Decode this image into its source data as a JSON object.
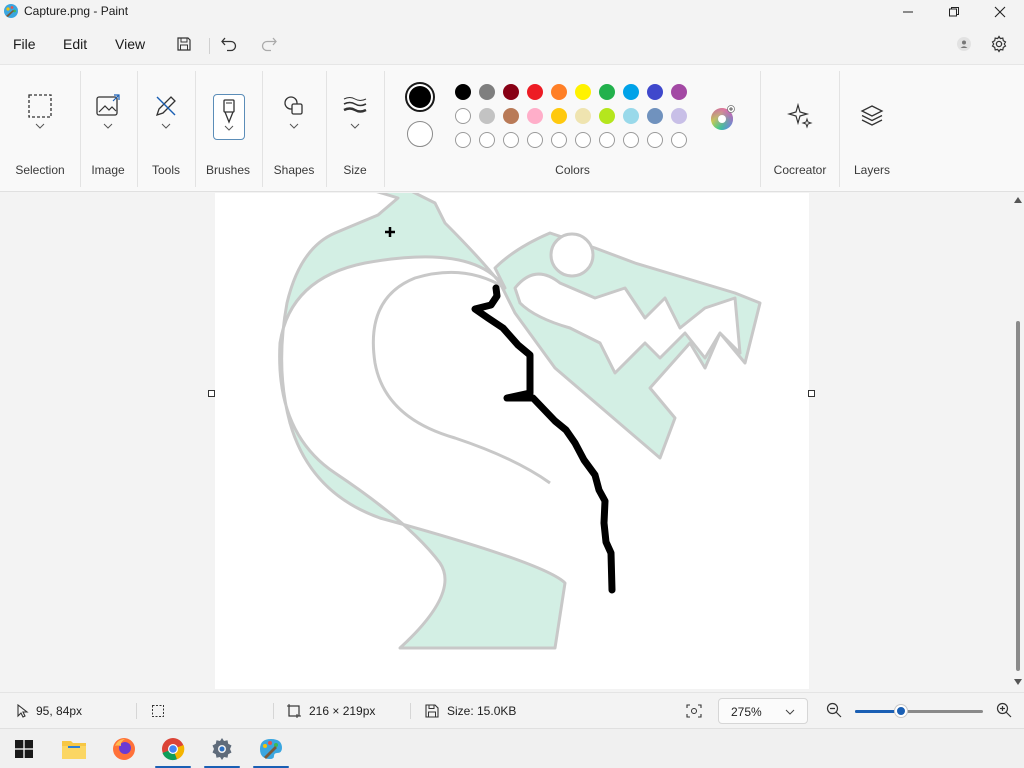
{
  "window": {
    "title": "Capture.png - Paint",
    "app_icon": "paint-palette-icon"
  },
  "menu": {
    "file": "File",
    "edit": "Edit",
    "view": "View"
  },
  "ribbon": {
    "groups": {
      "selection": "Selection",
      "image": "Image",
      "tools": "Tools",
      "brushes": "Brushes",
      "shapes": "Shapes",
      "size": "Size",
      "colors": "Colors",
      "cocreator": "Cocreator",
      "layers": "Layers"
    },
    "primary_color": "#000000",
    "secondary_color": "#ffffff",
    "palette_row1": [
      "#000000",
      "#7f7f7f",
      "#880015",
      "#ed1c24",
      "#ff7f27",
      "#fff200",
      "#22b14c",
      "#00a2e8",
      "#3f48cc",
      "#a349a4"
    ],
    "palette_row2": [
      "#ffffff",
      "#c3c3c3",
      "#b97a57",
      "#ffaec9",
      "#ffc90e",
      "#efe4b0",
      "#b5e61d",
      "#99d9ea",
      "#7092be",
      "#c8bfe7"
    ],
    "palette_row3_empty_count": 10
  },
  "status": {
    "cursor_pos": "95, 84px",
    "selection_size": "216 × 219px",
    "file_size": "Size: 15.0KB",
    "zoom": "275%",
    "zoom_slider_fraction": 0.36
  },
  "taskbar": {
    "apps": [
      "windows-start-icon",
      "file-explorer-icon",
      "firefox-icon",
      "chrome-icon",
      "settings-icon",
      "paint-icon"
    ]
  }
}
